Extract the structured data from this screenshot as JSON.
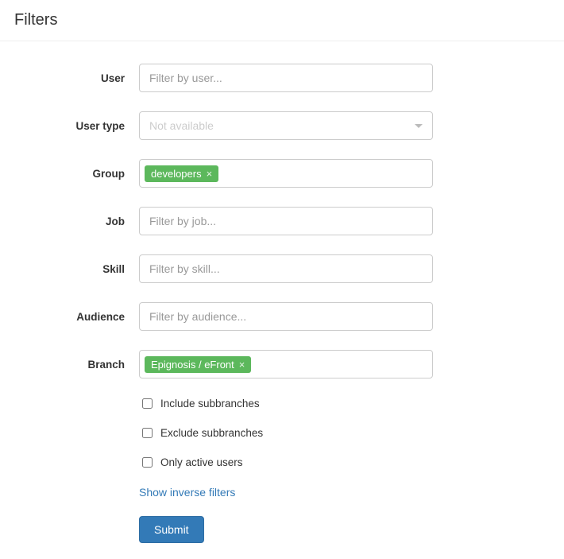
{
  "header": {
    "title": "Filters"
  },
  "fields": {
    "user": {
      "label": "User",
      "placeholder": "Filter by user..."
    },
    "user_type": {
      "label": "User type",
      "placeholder": "Not available"
    },
    "group": {
      "label": "Group",
      "tags": [
        "developers"
      ]
    },
    "job": {
      "label": "Job",
      "placeholder": "Filter by job..."
    },
    "skill": {
      "label": "Skill",
      "placeholder": "Filter by skill..."
    },
    "audience": {
      "label": "Audience",
      "placeholder": "Filter by audience..."
    },
    "branch": {
      "label": "Branch",
      "tags": [
        "Epignosis / eFront"
      ]
    }
  },
  "checkboxes": {
    "include_sub": {
      "label": "Include subbranches",
      "checked": false
    },
    "exclude_sub": {
      "label": "Exclude subbranches",
      "checked": false
    },
    "active_only": {
      "label": "Only active users",
      "checked": false
    }
  },
  "actions": {
    "inverse_link": "Show inverse filters",
    "submit": "Submit"
  }
}
